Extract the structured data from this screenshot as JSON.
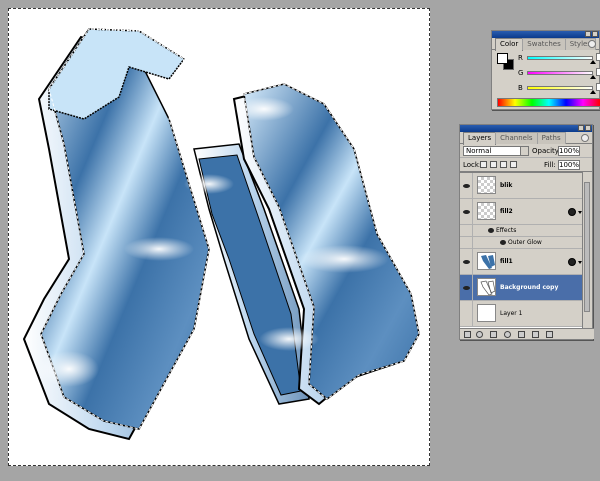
{
  "color_palette": {
    "tabs": [
      {
        "label": "Color",
        "active": true
      },
      {
        "label": "Swatches",
        "active": false
      },
      {
        "label": "Styles",
        "active": false
      }
    ],
    "channels": [
      {
        "label": "R",
        "bar_from": "#00ffff",
        "bar_to": "#ffffff"
      },
      {
        "label": "G",
        "bar_from": "#ff00ff",
        "bar_to": "#ffffff"
      },
      {
        "label": "B",
        "bar_from": "#ffff00",
        "bar_to": "#ffffff"
      }
    ],
    "foreground_color": "#ffffff",
    "background_color": "#000000"
  },
  "layers_palette": {
    "tabs": [
      {
        "label": "Layers",
        "active": true
      },
      {
        "label": "Channels",
        "active": false
      },
      {
        "label": "Paths",
        "active": false
      }
    ],
    "blend_mode": "Normal",
    "opacity_label": "Opacity:",
    "opacity_value": "100%",
    "lock_label": "Lock:",
    "fill_label": "Fill:",
    "fill_value": "100%",
    "layers": [
      {
        "name": "blik",
        "visible": true,
        "selected": false
      },
      {
        "name": "fill2",
        "visible": true,
        "selected": false,
        "has_effects": true
      },
      {
        "name": "fill1",
        "visible": true,
        "selected": false,
        "has_effects": true
      },
      {
        "name": "Background copy",
        "visible": true,
        "selected": true
      },
      {
        "name": "Layer 1",
        "visible": false,
        "selected": false
      }
    ],
    "effects_label": "Effects",
    "outer_glow_label": "Outer Glow"
  },
  "colors": {
    "workspace": "#a5a5a5",
    "letter_blue": "#3c72a8",
    "letter_light": "#c8e4f8",
    "selected_layer": "#4a6ea9"
  }
}
